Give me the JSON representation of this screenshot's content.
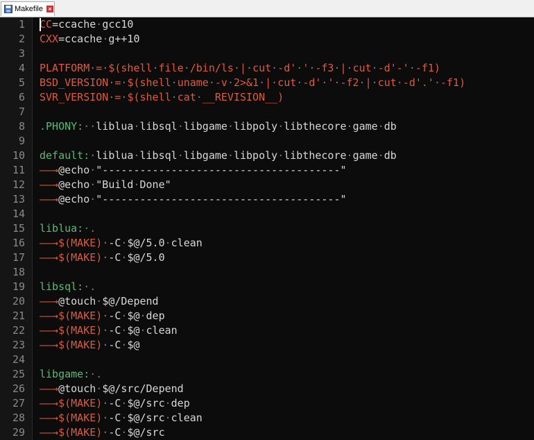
{
  "tab": {
    "label": "Makefile",
    "icon": "file-save-icon",
    "close_icon": "close-icon"
  },
  "lines": [
    {
      "n": "1",
      "segs": [
        [
          "var",
          "CC"
        ],
        [
          "def",
          "=ccache"
        ],
        [
          "dot",
          "·"
        ],
        [
          "def",
          "gcc10"
        ]
      ]
    },
    {
      "n": "2",
      "segs": [
        [
          "var",
          "CXX"
        ],
        [
          "def",
          "=ccache"
        ],
        [
          "dot",
          "·"
        ],
        [
          "def",
          "g++10"
        ]
      ]
    },
    {
      "n": "3",
      "segs": []
    },
    {
      "n": "4",
      "segs": [
        [
          "var",
          "PLATFORM"
        ],
        [
          "dot",
          "·"
        ],
        [
          "var",
          "="
        ],
        [
          "dot",
          "·"
        ],
        [
          "var",
          "$(shell"
        ],
        [
          "dot",
          "·"
        ],
        [
          "var",
          "file"
        ],
        [
          "dot",
          "·"
        ],
        [
          "var",
          "/bin/ls"
        ],
        [
          "dot",
          "·"
        ],
        [
          "var",
          "|"
        ],
        [
          "dot",
          "·"
        ],
        [
          "var",
          "cut"
        ],
        [
          "dot",
          "·"
        ],
        [
          "var",
          "-d'"
        ],
        [
          "dot",
          "·"
        ],
        [
          "var",
          "'"
        ],
        [
          "dot",
          "·"
        ],
        [
          "var",
          "-f3"
        ],
        [
          "dot",
          "·"
        ],
        [
          "var",
          "|"
        ],
        [
          "dot",
          "·"
        ],
        [
          "var",
          "cut"
        ],
        [
          "dot",
          "·"
        ],
        [
          "var",
          "-d'-'"
        ],
        [
          "dot",
          "·"
        ],
        [
          "var",
          "-f1)"
        ]
      ]
    },
    {
      "n": "5",
      "segs": [
        [
          "var",
          "BSD_VERSION"
        ],
        [
          "dot",
          "·"
        ],
        [
          "var",
          "="
        ],
        [
          "dot",
          "·"
        ],
        [
          "var",
          "$(shell"
        ],
        [
          "dot",
          "·"
        ],
        [
          "var",
          "uname"
        ],
        [
          "dot",
          "·"
        ],
        [
          "var",
          "-v"
        ],
        [
          "dot",
          "·"
        ],
        [
          "var",
          "2>&1"
        ],
        [
          "dot",
          "·"
        ],
        [
          "var",
          "|"
        ],
        [
          "dot",
          "·"
        ],
        [
          "var",
          "cut"
        ],
        [
          "dot",
          "·"
        ],
        [
          "var",
          "-d'"
        ],
        [
          "dot",
          "·"
        ],
        [
          "var",
          "'"
        ],
        [
          "dot",
          "·"
        ],
        [
          "var",
          "-f2"
        ],
        [
          "dot",
          "·"
        ],
        [
          "var",
          "|"
        ],
        [
          "dot",
          "·"
        ],
        [
          "var",
          "cut"
        ],
        [
          "dot",
          "·"
        ],
        [
          "var",
          "-d'.'"
        ],
        [
          "dot",
          "·"
        ],
        [
          "var",
          "-f1)"
        ]
      ]
    },
    {
      "n": "6",
      "segs": [
        [
          "var",
          "SVR_VERSION"
        ],
        [
          "dot",
          "·"
        ],
        [
          "var",
          "="
        ],
        [
          "dot",
          "·"
        ],
        [
          "var",
          "$(shell"
        ],
        [
          "dot",
          "·"
        ],
        [
          "var",
          "cat"
        ],
        [
          "dot",
          "·"
        ],
        [
          "var",
          "__REVISION__)"
        ]
      ]
    },
    {
      "n": "7",
      "segs": []
    },
    {
      "n": "8",
      "segs": [
        [
          "tgt",
          ".PHONY:"
        ],
        [
          "dot",
          "··"
        ],
        [
          "def",
          "liblua"
        ],
        [
          "dot",
          "·"
        ],
        [
          "def",
          "libsql"
        ],
        [
          "dot",
          "·"
        ],
        [
          "def",
          "libgame"
        ],
        [
          "dot",
          "·"
        ],
        [
          "def",
          "libpoly"
        ],
        [
          "dot",
          "·"
        ],
        [
          "def",
          "libthecore"
        ],
        [
          "dot",
          "·"
        ],
        [
          "def",
          "game"
        ],
        [
          "dot",
          "·"
        ],
        [
          "def",
          "db"
        ]
      ]
    },
    {
      "n": "9",
      "segs": []
    },
    {
      "n": "10",
      "segs": [
        [
          "tgt",
          "default:"
        ],
        [
          "dot",
          "·"
        ],
        [
          "def",
          "liblua"
        ],
        [
          "dot",
          "·"
        ],
        [
          "def",
          "libsql"
        ],
        [
          "dot",
          "·"
        ],
        [
          "def",
          "libgame"
        ],
        [
          "dot",
          "·"
        ],
        [
          "def",
          "libpoly"
        ],
        [
          "dot",
          "·"
        ],
        [
          "def",
          "libthecore"
        ],
        [
          "dot",
          "·"
        ],
        [
          "def",
          "game"
        ],
        [
          "dot",
          "·"
        ],
        [
          "def",
          "db"
        ]
      ]
    },
    {
      "n": "11",
      "segs": [
        [
          "tab",
          "——→"
        ],
        [
          "def",
          "@echo"
        ],
        [
          "dot",
          "·"
        ],
        [
          "def",
          "\"--------------------------------------\""
        ]
      ]
    },
    {
      "n": "12",
      "segs": [
        [
          "tab",
          "——→"
        ],
        [
          "def",
          "@echo"
        ],
        [
          "dot",
          "·"
        ],
        [
          "def",
          "\"Build"
        ],
        [
          "dot",
          "·"
        ],
        [
          "def",
          "Done\""
        ]
      ]
    },
    {
      "n": "13",
      "segs": [
        [
          "tab",
          "——→"
        ],
        [
          "def",
          "@echo"
        ],
        [
          "dot",
          "·"
        ],
        [
          "def",
          "\"--------------------------------------\""
        ]
      ]
    },
    {
      "n": "14",
      "segs": []
    },
    {
      "n": "15",
      "segs": [
        [
          "tgt",
          "liblua:"
        ],
        [
          "dot",
          "·."
        ]
      ]
    },
    {
      "n": "16",
      "segs": [
        [
          "tab",
          "——→"
        ],
        [
          "var",
          "$(MAKE)"
        ],
        [
          "dot",
          "·"
        ],
        [
          "def",
          "-C"
        ],
        [
          "dot",
          "·"
        ],
        [
          "def",
          "$@/5.0"
        ],
        [
          "dot",
          "·"
        ],
        [
          "def",
          "clean"
        ]
      ]
    },
    {
      "n": "17",
      "segs": [
        [
          "tab",
          "——→"
        ],
        [
          "var",
          "$(MAKE)"
        ],
        [
          "dot",
          "·"
        ],
        [
          "def",
          "-C"
        ],
        [
          "dot",
          "·"
        ],
        [
          "def",
          "$@/5.0"
        ]
      ]
    },
    {
      "n": "18",
      "segs": []
    },
    {
      "n": "19",
      "segs": [
        [
          "tgt",
          "libsql:"
        ],
        [
          "dot",
          "·."
        ]
      ]
    },
    {
      "n": "20",
      "segs": [
        [
          "tab",
          "——→"
        ],
        [
          "def",
          "@touch"
        ],
        [
          "dot",
          "·"
        ],
        [
          "def",
          "$@/Depend"
        ]
      ]
    },
    {
      "n": "21",
      "segs": [
        [
          "tab",
          "——→"
        ],
        [
          "var",
          "$(MAKE)"
        ],
        [
          "dot",
          "·"
        ],
        [
          "def",
          "-C"
        ],
        [
          "dot",
          "·"
        ],
        [
          "def",
          "$@"
        ],
        [
          "dot",
          "·"
        ],
        [
          "def",
          "dep"
        ]
      ]
    },
    {
      "n": "22",
      "segs": [
        [
          "tab",
          "——→"
        ],
        [
          "var",
          "$(MAKE)"
        ],
        [
          "dot",
          "·"
        ],
        [
          "def",
          "-C"
        ],
        [
          "dot",
          "·"
        ],
        [
          "def",
          "$@"
        ],
        [
          "dot",
          "·"
        ],
        [
          "def",
          "clean"
        ]
      ]
    },
    {
      "n": "23",
      "segs": [
        [
          "tab",
          "——→"
        ],
        [
          "var",
          "$(MAKE)"
        ],
        [
          "dot",
          "·"
        ],
        [
          "def",
          "-C"
        ],
        [
          "dot",
          "·"
        ],
        [
          "def",
          "$@"
        ]
      ]
    },
    {
      "n": "24",
      "segs": []
    },
    {
      "n": "25",
      "segs": [
        [
          "tgt",
          "libgame:"
        ],
        [
          "dot",
          "·."
        ]
      ]
    },
    {
      "n": "26",
      "segs": [
        [
          "tab",
          "——→"
        ],
        [
          "def",
          "@touch"
        ],
        [
          "dot",
          "·"
        ],
        [
          "def",
          "$@/src/Depend"
        ]
      ]
    },
    {
      "n": "27",
      "segs": [
        [
          "tab",
          "——→"
        ],
        [
          "var",
          "$(MAKE)"
        ],
        [
          "dot",
          "·"
        ],
        [
          "def",
          "-C"
        ],
        [
          "dot",
          "·"
        ],
        [
          "def",
          "$@/src"
        ],
        [
          "dot",
          "·"
        ],
        [
          "def",
          "dep"
        ]
      ]
    },
    {
      "n": "28",
      "segs": [
        [
          "tab",
          "——→"
        ],
        [
          "var",
          "$(MAKE)"
        ],
        [
          "dot",
          "·"
        ],
        [
          "def",
          "-C"
        ],
        [
          "dot",
          "·"
        ],
        [
          "def",
          "$@/src"
        ],
        [
          "dot",
          "·"
        ],
        [
          "def",
          "clean"
        ]
      ]
    },
    {
      "n": "29",
      "segs": [
        [
          "tab",
          "——→"
        ],
        [
          "var",
          "$(MAKE)"
        ],
        [
          "dot",
          "·"
        ],
        [
          "def",
          "-C"
        ],
        [
          "dot",
          "·"
        ],
        [
          "def",
          "$@/src"
        ]
      ]
    }
  ],
  "colors": {
    "background": "#0c0c0c",
    "variable": "#e05a3c",
    "target": "#5fb87a",
    "default": "#d8d8d8",
    "line_number": "#8a8a8a"
  }
}
